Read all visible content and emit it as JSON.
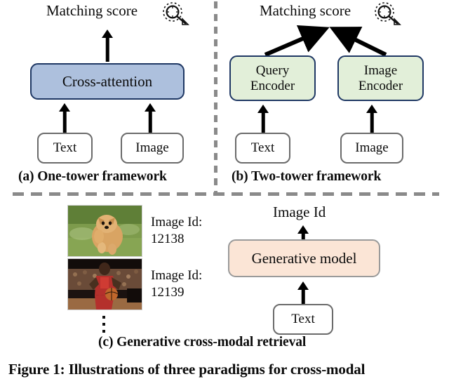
{
  "figure": {
    "caption": "Figure 1: Illustrations of three paradigms for cross-modal"
  },
  "panel_a": {
    "sublabel": "(a) One-tower framework",
    "output_label": "Matching score",
    "output_icon": "magnifier-icon",
    "model_box": "Cross-attention",
    "inputs": [
      {
        "label": "Text"
      },
      {
        "label": "Image"
      }
    ]
  },
  "panel_b": {
    "sublabel": "(b) Two-tower framework",
    "output_label": "Matching score",
    "output_icon": "magnifier-icon",
    "encoders": [
      {
        "line1": "Query",
        "line2": "Encoder"
      },
      {
        "line1": "Image",
        "line2": "Encoder"
      }
    ],
    "inputs": [
      {
        "label": "Text"
      },
      {
        "label": "Image"
      }
    ]
  },
  "panel_c": {
    "sublabel": "(c) Generative cross-modal retrieval",
    "output_label": "Image Id",
    "model_box": "Generative model",
    "input_box": "Text",
    "corpus": [
      {
        "thumbnail": "pomeranian-dog-on-grass",
        "id_label": "Image Id:",
        "id_value": "12138"
      },
      {
        "thumbnail": "basketball-player-dribbling",
        "id_label": "Image Id:",
        "id_value": "12139"
      }
    ],
    "corpus_more": "vertical-ellipsis"
  },
  "colors": {
    "cross_attention_fill": "#adc0dd",
    "cross_attention_border": "#1f3864",
    "encoder_fill": "#e2efd9",
    "encoder_border": "#1f3864",
    "generative_fill": "#fbe5d6",
    "generative_border": "#9a9a9a",
    "input_border": "#6b6b6b",
    "divider": "#8a8a8a",
    "arrow": "#000000"
  }
}
